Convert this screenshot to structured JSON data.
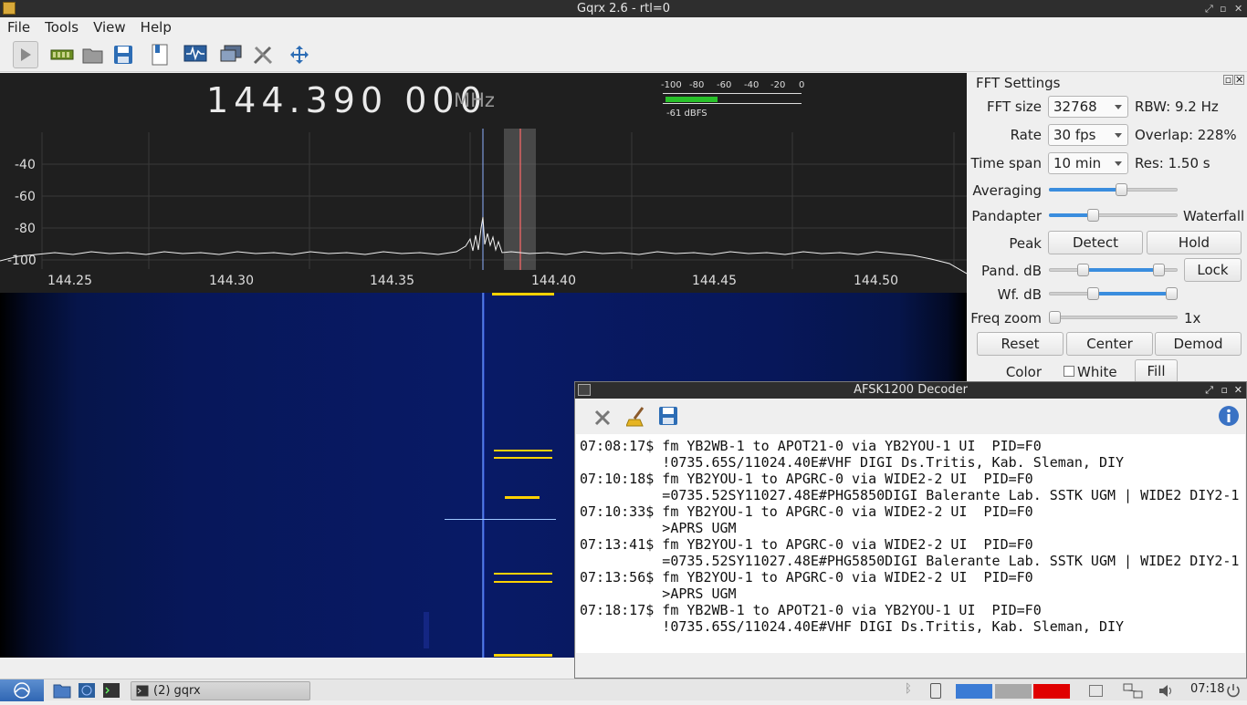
{
  "window": {
    "title": "Gqrx 2.6 - rtl=0"
  },
  "menu": [
    "File",
    "Tools",
    "View",
    "Help"
  ],
  "toolbar": {
    "icons": [
      "play-icon",
      "device-icon",
      "open-icon",
      "save-icon",
      "bookmark-icon",
      "remote-icon",
      "screen-icon",
      "settings-icon",
      "fullscreen-icon"
    ]
  },
  "frequency": {
    "value": "144.390 000",
    "unit": "MHz"
  },
  "meter": {
    "scale": [
      "-100",
      "-80",
      "-60",
      "-40",
      "-20",
      "0"
    ],
    "reading": "-61 dBFS",
    "level_fraction": 0.39
  },
  "plot": {
    "db_labels": [
      "-40",
      "-60",
      "-80",
      "-100"
    ],
    "freq_labels": [
      "144.25",
      "144.30",
      "144.35",
      "144.40",
      "144.45",
      "144.50"
    ]
  },
  "fft_settings": {
    "title": "FFT Settings",
    "fft_size_label": "FFT size",
    "fft_size_value": "32768",
    "rbw": "RBW: 9.2 Hz",
    "rate_label": "Rate",
    "rate_value": "30 fps",
    "overlap": "Overlap: 228%",
    "timespan_label": "Time span",
    "timespan_value": "10 min",
    "res": "Res: 1.50 s",
    "averaging_label": "Averaging",
    "averaging_level": 0.57,
    "pandapter_label": "Pandapter",
    "waterfall_label": "Waterfall",
    "pandapter_level": 0.33,
    "peak_label": "Peak",
    "detect_button": "Detect",
    "hold_button": "Hold",
    "pand_db_label": "Pand. dB",
    "lock_button": "Lock",
    "wf_db_label": "Wf. dB",
    "freq_zoom_label": "Freq zoom",
    "freq_zoom_value": "1x",
    "reset_button": "Reset",
    "center_button": "Center",
    "demod_button": "Demod",
    "color_label": "Color",
    "white_label": "White",
    "fill_button": "Fill"
  },
  "decoder": {
    "title": "AFSK1200 Decoder",
    "log": [
      {
        "time": "07:08:17$",
        "header": "fm YB2WB-1 to APOT21-0 via YB2YOU-1 UI  PID=F0",
        "body": "!0735.65S/11024.40E#VHF DIGI Ds.Tritis, Kab. Sleman, DIY"
      },
      {
        "time": "07:10:18$",
        "header": "fm YB2YOU-1 to APGRC-0 via WIDE2-2 UI  PID=F0",
        "body": "=0735.52SY11027.48E#PHG5850DIGI Balerante Lab. SSTK UGM | WIDE2 DIY2-1"
      },
      {
        "time": "07:10:33$",
        "header": "fm YB2YOU-1 to APGRC-0 via WIDE2-2 UI  PID=F0",
        "body": ">APRS UGM"
      },
      {
        "time": "07:13:41$",
        "header": "fm YB2YOU-1 to APGRC-0 via WIDE2-2 UI  PID=F0",
        "body": "=0735.52SY11027.48E#PHG5850DIGI Balerante Lab. SSTK UGM | WIDE2 DIY2-1"
      },
      {
        "time": "07:13:56$",
        "header": "fm YB2YOU-1 to APGRC-0 via WIDE2-2 UI  PID=F0",
        "body": ">APRS UGM"
      },
      {
        "time": "07:18:17$",
        "header": "fm YB2WB-1 to APOT21-0 via YB2YOU-1 UI  PID=F0",
        "body": "!0735.65S/11024.40E#VHF DIGI Ds.Tritis, Kab. Sleman, DIY"
      }
    ]
  },
  "taskbar": {
    "task_label": "(2) gqrx",
    "clock": "07:18"
  },
  "colors": {
    "waterfall_signal": "#ffd200",
    "marker": "#ff6a6a",
    "meter": "#29c12a"
  }
}
